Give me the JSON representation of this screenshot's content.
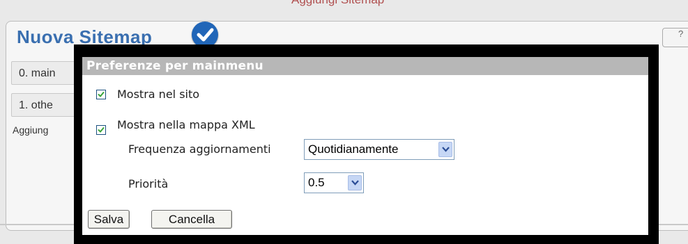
{
  "background": {
    "top_link": "Aggiungi Sitemap",
    "panel_title": "Nuova Sitemap",
    "rows": [
      "0. main",
      "1. othe"
    ],
    "add_text": "Aggiung",
    "right_button_label": "?",
    "colors": {
      "title": "#3a6fb0",
      "badge": "#2166b8"
    }
  },
  "dialog": {
    "title": "Preferenze per mainmenu",
    "show_on_site": {
      "label": "Mostra nel sito",
      "checked": true
    },
    "show_in_xml": {
      "label": "Mostra nella mappa XML",
      "checked": true
    },
    "frequency": {
      "label": "Frequenza aggiornamenti",
      "value": "Quotidianamente"
    },
    "priority": {
      "label": "Priorità",
      "value": "0.5"
    },
    "buttons": {
      "save": "Salva",
      "cancel": "Cancella"
    },
    "colors": {
      "header": "#b7b7b7",
      "frame": "#000000",
      "checkmark": "#3aa53a"
    }
  }
}
